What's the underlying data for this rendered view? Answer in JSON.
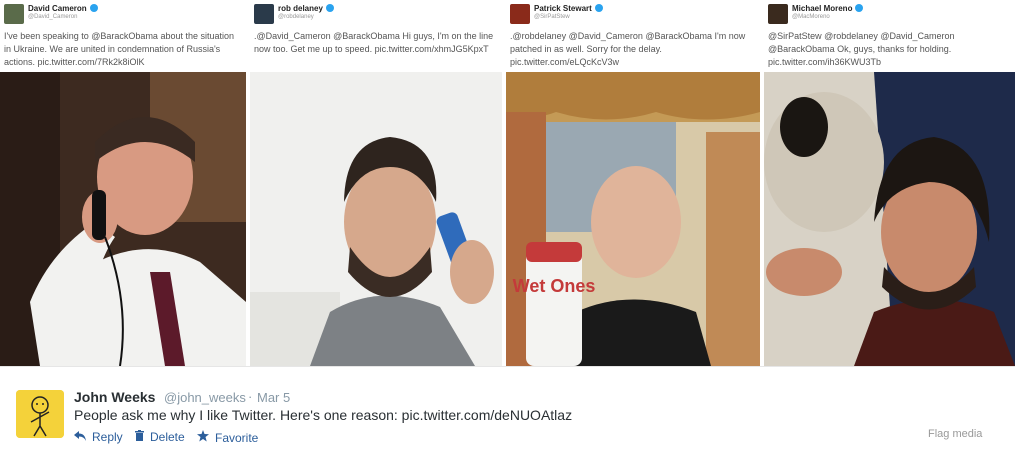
{
  "panels": [
    {
      "name": "David Cameron",
      "handle": "@David_Cameron",
      "text": "I've been speaking to @BarackObama about the situation in Ukraine. We are united in condemnation of Russia's actions. pic.twitter.com/7Rk2k8iOlK",
      "photo_icon": "man-on-phone-photo"
    },
    {
      "name": "rob delaney",
      "handle": "@robdelaney",
      "text": ".@David_Cameron @BarackObama Hi guys, I'm on the line now too. Get me up to speed. pic.twitter.com/xhmJG5KpxT",
      "photo_icon": "man-with-toothpaste-photo"
    },
    {
      "name": "Patrick Stewart",
      "handle": "@SirPatStew",
      "text": ".@robdelaney @David_Cameron @BarackObama I'm now patched in as well. Sorry for the delay. pic.twitter.com/eLQcKcV3w",
      "photo_icon": "man-with-wipes-photo",
      "wipes_label": "Wet Ones"
    },
    {
      "name": "Michael Moreno",
      "handle": "@MacMoreno",
      "text": "@SirPatStew @robdelaney @David_Cameron @BarackObama Ok, guys, thanks for holding. pic.twitter.com/ih36KWU3Tb",
      "photo_icon": "man-with-pug-photo"
    }
  ],
  "tweet": {
    "name": "John Weeks",
    "handle": "@john_weeks",
    "separator": "·",
    "date": "Mar 5",
    "text": "People ask me why I like Twitter. Here's one reason: pic.twitter.com/deNUOAtlaz",
    "avatar_icon": "stick-figure-avatar",
    "actions": {
      "reply": "Reply",
      "delete": "Delete",
      "favorite": "Favorite"
    },
    "flag": "Flag media"
  },
  "colors": {
    "link": "#2c5e9b",
    "muted": "#8899a6",
    "verified": "#2aa3ef",
    "avatar_bg": "#f4d23a"
  }
}
